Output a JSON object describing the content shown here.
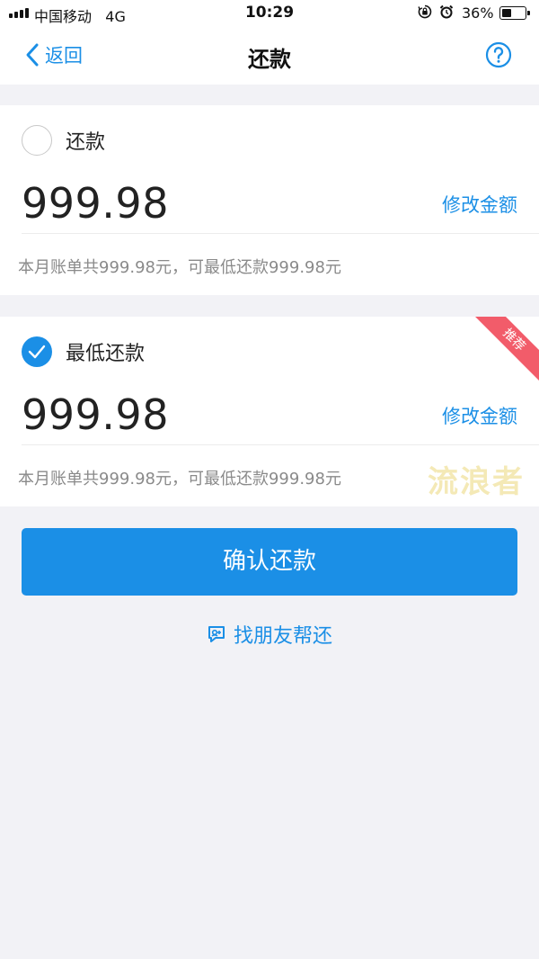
{
  "status_bar": {
    "carrier": "中国移动",
    "network": "4G",
    "time": "10:29",
    "battery_percent": "36%",
    "battery_level": 0.36,
    "icons": [
      "signal-icon",
      "orientation-lock-icon",
      "alarm-icon",
      "battery-icon"
    ]
  },
  "nav": {
    "back_label": "返回",
    "title": "还款",
    "help_icon": "help-icon"
  },
  "options": [
    {
      "label": "还款",
      "selected": false,
      "amount": "999.98",
      "modify_label": "修改金额",
      "bill_text": "本月账单共999.98元，可最低还款999.98元"
    },
    {
      "label": "最低还款",
      "selected": true,
      "amount": "999.98",
      "modify_label": "修改金额",
      "bill_text": "本月账单共999.98元，可最低还款999.98元",
      "ribbon": "推荐"
    }
  ],
  "watermark": "流浪者",
  "confirm_button": "确认还款",
  "friend_help": {
    "label": "找朋友帮还",
    "icon": "chat-icon"
  },
  "colors": {
    "accent": "#1b8fe6",
    "ribbon": "#f25c6a",
    "background": "#f2f2f6"
  }
}
